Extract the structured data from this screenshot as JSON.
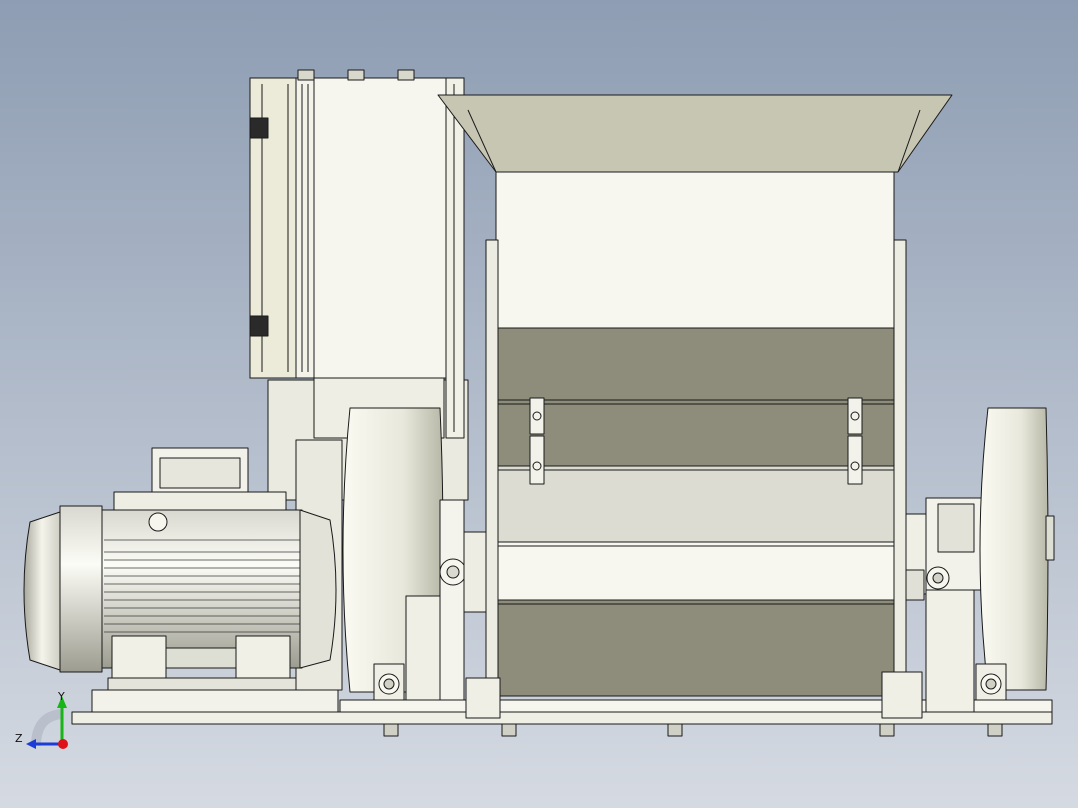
{
  "viewport": {
    "background_top": "#8e9db3",
    "background_bottom": "#d5dae2"
  },
  "model": {
    "body_color": "#f4f4ea",
    "panel_color": "#ecead8",
    "band_color": "#8e8c7a",
    "light_band_color": "#dcdcd2",
    "hopper_color": "#c7c6b3",
    "outline_color": "#1a1a1a"
  },
  "triad": {
    "y_label": "Y",
    "z_label": "Z",
    "x_color": "#e0101a",
    "y_color": "#18b418",
    "z_color": "#1d3bd6"
  }
}
